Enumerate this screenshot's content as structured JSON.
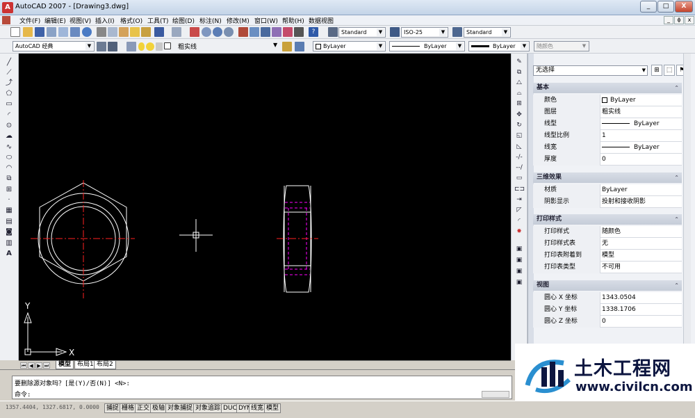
{
  "window": {
    "title": "AutoCAD 2007 - [Drawing3.dwg]",
    "minimize": "_",
    "maximize": "□",
    "close": "X"
  },
  "menu": [
    "文件(F)",
    "编辑(E)",
    "视图(V)",
    "插入(I)",
    "格式(O)",
    "工具(T)",
    "绘图(D)",
    "标注(N)",
    "修改(M)",
    "窗口(W)",
    "帮助(H)",
    "数据视图"
  ],
  "doc_controls": [
    "_",
    "ɸ",
    "x"
  ],
  "toolbar1": {
    "text_style": "Standard",
    "dim_style": "ISO-25",
    "table_style": "Standard"
  },
  "toolbar2": {
    "workspace": "AutoCAD 经典",
    "layer": "粗实线",
    "color": "ByLayer",
    "linetype": "ByLayer",
    "lineweight": "ByLayer",
    "plot_style": "随颜色"
  },
  "tabs": [
    "模型",
    "布局1",
    "布局2"
  ],
  "ucs": {
    "y_label": "Y",
    "x_label": "X"
  },
  "properties": {
    "selection": "无选择",
    "sections": [
      {
        "title": "基本",
        "rows": [
          {
            "k": "颜色",
            "v": "ByLayer",
            "swatch": true
          },
          {
            "k": "图层",
            "v": "粗实线"
          },
          {
            "k": "线型",
            "v": "ByLayer",
            "line": true
          },
          {
            "k": "线型比例",
            "v": "1"
          },
          {
            "k": "线宽",
            "v": "ByLayer",
            "line": true
          },
          {
            "k": "厚度",
            "v": "0"
          }
        ]
      },
      {
        "title": "三维效果",
        "rows": [
          {
            "k": "材质",
            "v": "ByLayer"
          },
          {
            "k": "阴影显示",
            "v": "投射和接收阴影"
          }
        ]
      },
      {
        "title": "打印样式",
        "rows": [
          {
            "k": "打印样式",
            "v": "随颜色"
          },
          {
            "k": "打印样式表",
            "v": "无"
          },
          {
            "k": "打印表附着到",
            "v": "模型"
          },
          {
            "k": "打印表类型",
            "v": "不可用"
          }
        ]
      },
      {
        "title": "视图",
        "rows": [
          {
            "k": "圆心 X 坐标",
            "v": "1343.0504"
          },
          {
            "k": "圆心 Y 坐标",
            "v": "1338.1706"
          },
          {
            "k": "圆心 Z 坐标",
            "v": "0"
          }
        ]
      }
    ]
  },
  "command": {
    "line1": "要删除源对象吗？[是(Y)/否(N)] <N>:",
    "line2": "命令:"
  },
  "status": {
    "coords": "1357.4404, 1327.6817, 0.0000",
    "buttons": [
      "捕捉",
      "栅格",
      "正交",
      "极轴",
      "对象捕捉",
      "对象追踪",
      "DUCS",
      "DYN",
      "线宽",
      "模型"
    ]
  },
  "watermark": {
    "name": "土木工程网",
    "url": "www.civilcn.com"
  },
  "colors": {
    "canvas": "#000000",
    "geometry": "#ffffff",
    "centerline": "#ff0000",
    "hidden": "#ff00ff"
  }
}
